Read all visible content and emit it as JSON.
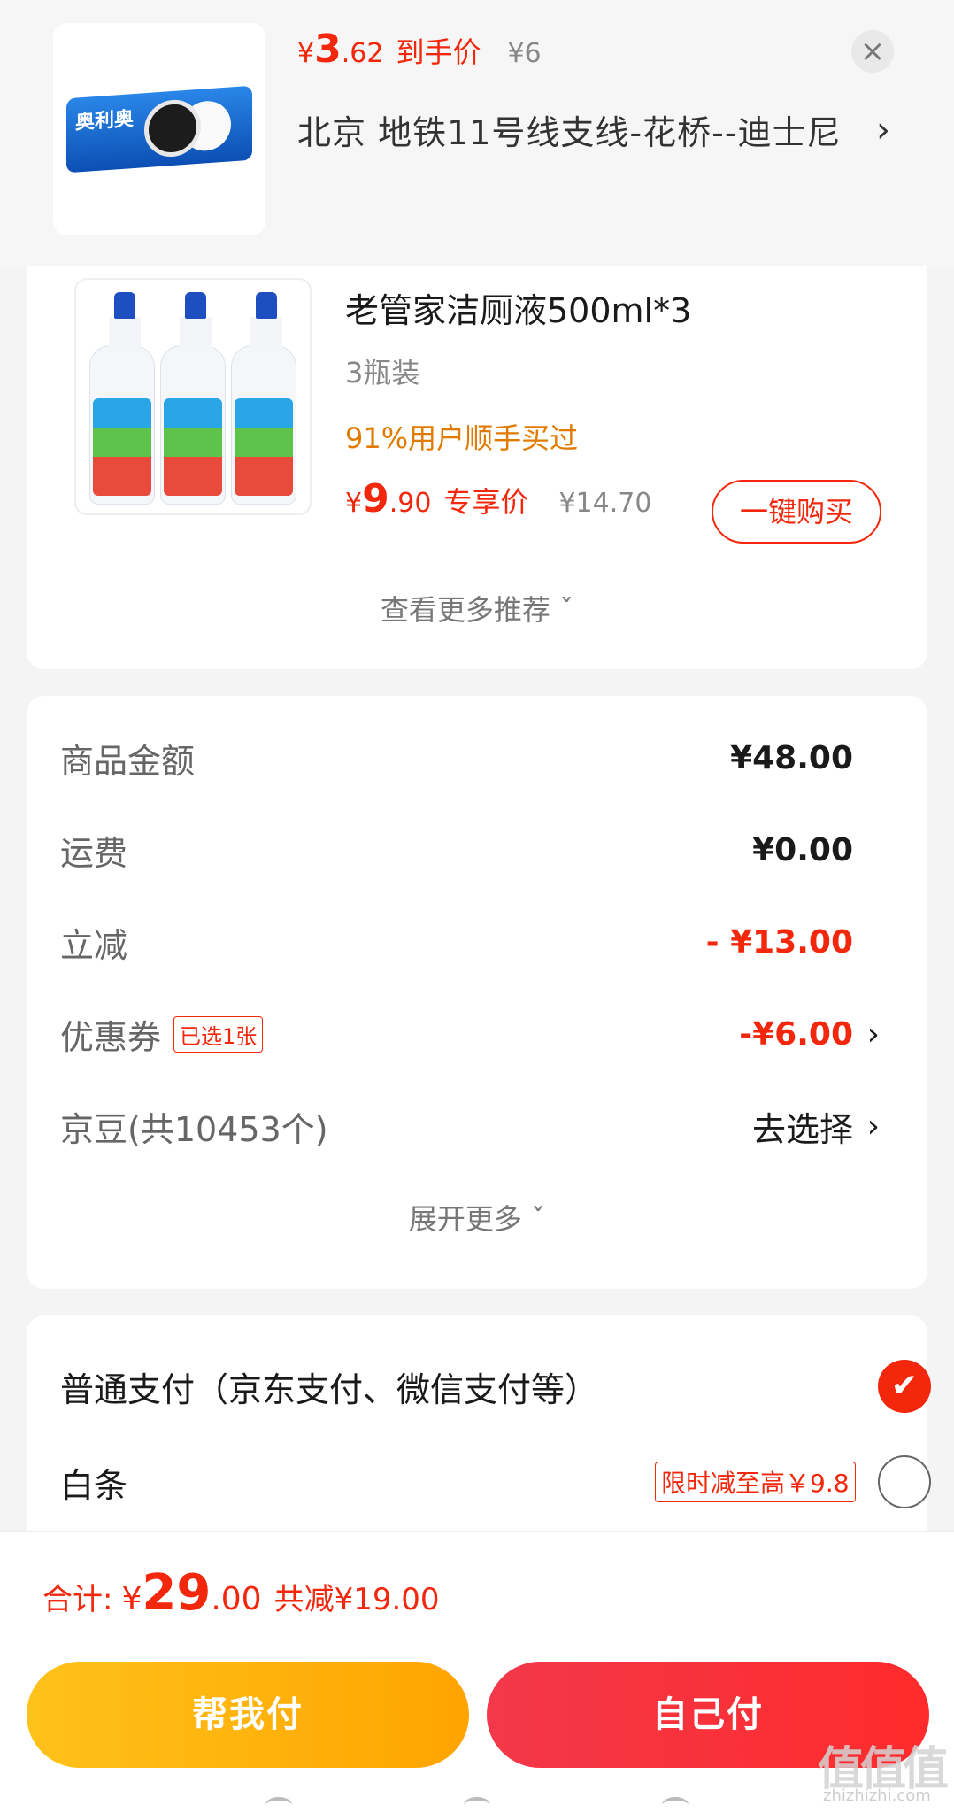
{
  "header": {
    "thumbnail_brand": "奥利奥",
    "price_yen": "¥",
    "price_int": "3",
    "price_dec": ".62",
    "price_label": "到手价",
    "original_price": "¥6",
    "address": "北京  地铁11号线支线-花桥--迪士尼",
    "close_icon": "close-icon",
    "address_chevron": "›"
  },
  "recommendation": {
    "product_name": "老管家洁厕液500ml*3",
    "spec": "3瓶装",
    "bought_stat": "91%用户顺手买过",
    "price_yen": "¥",
    "price_int": "9",
    "price_dec": ".90",
    "price_label": "专享价",
    "original_price": "¥14.70",
    "buy_button": "一键购买",
    "see_more": "查看更多推荐 ˇ"
  },
  "summary": {
    "rows": [
      {
        "label": "商品金额",
        "value": "¥48.00"
      },
      {
        "label": "运费",
        "value": "¥0.00"
      },
      {
        "label": "立减",
        "value": "- ¥13.00"
      },
      {
        "label": "优惠券",
        "tag": "已选1张",
        "value": "-¥6.00",
        "chevron": "›"
      },
      {
        "label": "京豆(共10453个)",
        "value": "去选择",
        "chevron": "›"
      }
    ],
    "expand_more": "展开更多 ˇ"
  },
  "payment": {
    "options": [
      {
        "label": "普通支付（京东支付、微信支付等）",
        "selected": true,
        "check": "✔"
      },
      {
        "label": "白条",
        "promo": "限时减至高￥9.8",
        "selected": false
      }
    ]
  },
  "bottom_bar": {
    "total_label": "合计:",
    "total_yen": "¥",
    "total_int": "29",
    "total_dec": ".00",
    "total_saved": "共减¥19.00",
    "help_pay": "帮我付",
    "self_pay": "自己付"
  },
  "watermark": {
    "text": "值值值",
    "sub": "zhizhizhi.com"
  },
  "colors": {
    "accent": "#f2270c",
    "orange": "#e07b00",
    "help_button": "#ffb300",
    "self_button": "#f2384a"
  }
}
